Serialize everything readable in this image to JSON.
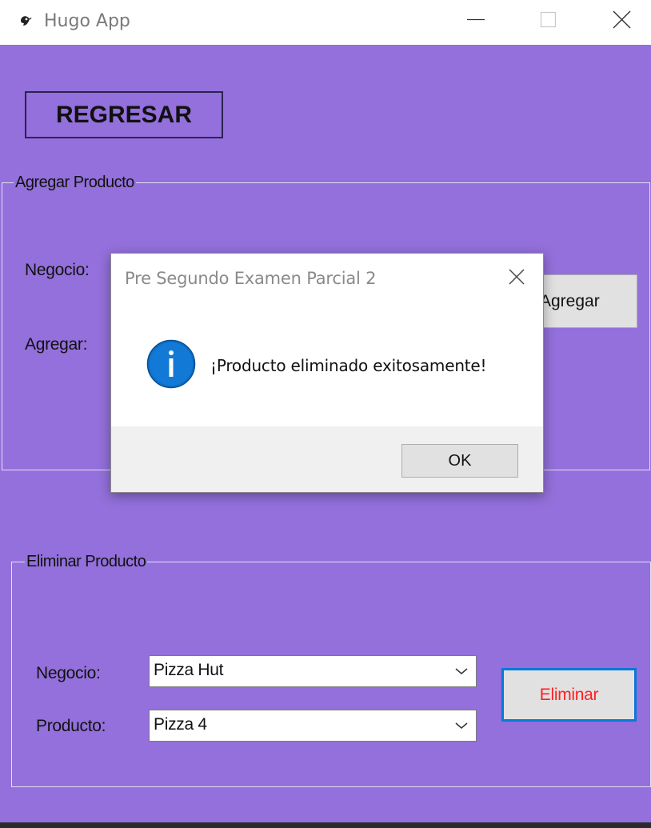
{
  "window": {
    "title": "Hugo App",
    "icon": "app-bird-icon",
    "controls": [
      "minimize-icon",
      "maximize-icon",
      "close-icon"
    ],
    "background": "#9370db"
  },
  "toolbar": {
    "back_label": "REGRESAR"
  },
  "add_group": {
    "legend": "Agregar Producto",
    "negocio_label": "Negocio:",
    "agregar_label": "Agregar:",
    "button_label": "Agregar"
  },
  "delete_group": {
    "legend": "Eliminar Producto",
    "negocio_label": "Negocio:",
    "producto_label": "Producto:",
    "negocio_value": "Pizza Hut",
    "producto_value": "Pizza 4",
    "button_label": "Eliminar",
    "button_text_color": "#ff1f1f",
    "button_focus_color": "#0a78d7"
  },
  "dialog": {
    "title": "Pre Segundo Examen Parcial 2",
    "message": "¡Producto eliminado exitosamente!",
    "icon": "info-icon",
    "icon_color": "#0067c0",
    "ok_label": "OK"
  }
}
